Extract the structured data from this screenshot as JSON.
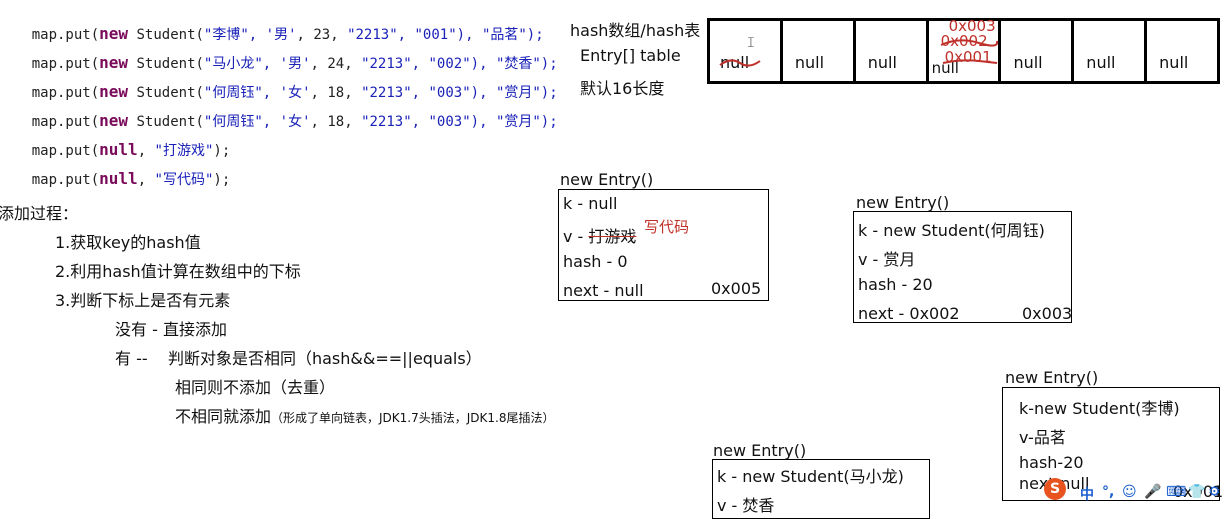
{
  "code_lines": [
    {
      "prefix": "map.put(",
      "kw": "new",
      "mid": " Student(",
      "str1": "\"李博\", '男'",
      "num": ", 23, ",
      "str2": "\"2213\", \"001\"), \"品茗\");"
    },
    {
      "prefix": "map.put(",
      "kw": "new",
      "mid": " Student(",
      "str1": "\"马小龙\", '男'",
      "num": ", 24, ",
      "str2": "\"2213\", \"002\"), \"焚香\");"
    },
    {
      "prefix": "map.put(",
      "kw": "new",
      "mid": " Student(",
      "str1": "\"何周钰\", '女'",
      "num": ", 18, ",
      "str2": "\"2213\", \"003\"), \"赏月\");"
    },
    {
      "prefix": "map.put(",
      "kw": "new",
      "mid": " Student(",
      "str1": "\"何周钰\", '女'",
      "num": ", 18, ",
      "str2": "\"2213\", \"003\"), \"赏月\");"
    },
    {
      "prefix": "map.put(",
      "kw": "null",
      "mid": ", ",
      "str1": "\"打游戏\"",
      "num": "",
      "str2": ");"
    },
    {
      "prefix": "map.put(",
      "kw": "null",
      "mid": ", ",
      "str1": "\"写代码\"",
      "num": "",
      "str2": ");"
    }
  ],
  "hash_labels": {
    "line1": "hash数组/hash表",
    "line2": "Entry[] table",
    "line3": "默认16长度"
  },
  "array_cells": [
    "null",
    "null",
    "null",
    "null",
    "null",
    "null",
    "null"
  ],
  "array_cell4_notes": [
    "0x003",
    "0x002",
    "0x001"
  ],
  "add_process": {
    "heading": "添加过程：",
    "step1": "1.获取key的hash值",
    "step2": "2.利用hash值计算在数组中的下标",
    "step3": "3.判断下标上是否有元素",
    "no_elem": "没有 - 直接添加",
    "has_elem": "有 --    判断对象是否相同（hash&&==||equals）",
    "same": "相同则不添加（去重）",
    "diff_main": "不相同就添加",
    "diff_note": "（形成了单向链表，JDK1.7头插法，JDK1.8尾插法）"
  },
  "entries": {
    "e_null": {
      "title": "new Entry()",
      "k": "k - null",
      "v_prefix": "v - ",
      "v_old": "打游戏",
      "v_new": "写代码",
      "hash": "hash - 0",
      "next": "next - null",
      "addr": "0x005"
    },
    "e_he": {
      "title": "new Entry()",
      "k": "k - new Student(何周钰)",
      "v": "v - 赏月",
      "hash": "hash - 20",
      "next": "next - 0x002",
      "addr": "0x003"
    },
    "e_li": {
      "title": "new Entry()",
      "k": "k-new Student(李博)",
      "v": "v-品茗",
      "hash": "hash-20",
      "next": "next-null",
      "addr": "0x001"
    },
    "e_ma": {
      "title": "new Entry()",
      "k": "k - new Student(马小龙)",
      "v": "v - 焚香"
    }
  },
  "taskbar": {
    "logo": "S",
    "items": [
      "中",
      "°,",
      "☺",
      "🎤",
      "⌨",
      "👕",
      "⚙"
    ]
  },
  "colors": {
    "keyword": "#7a0a5a",
    "string": "#1a22b8",
    "annotation_red": "#c0302a"
  }
}
